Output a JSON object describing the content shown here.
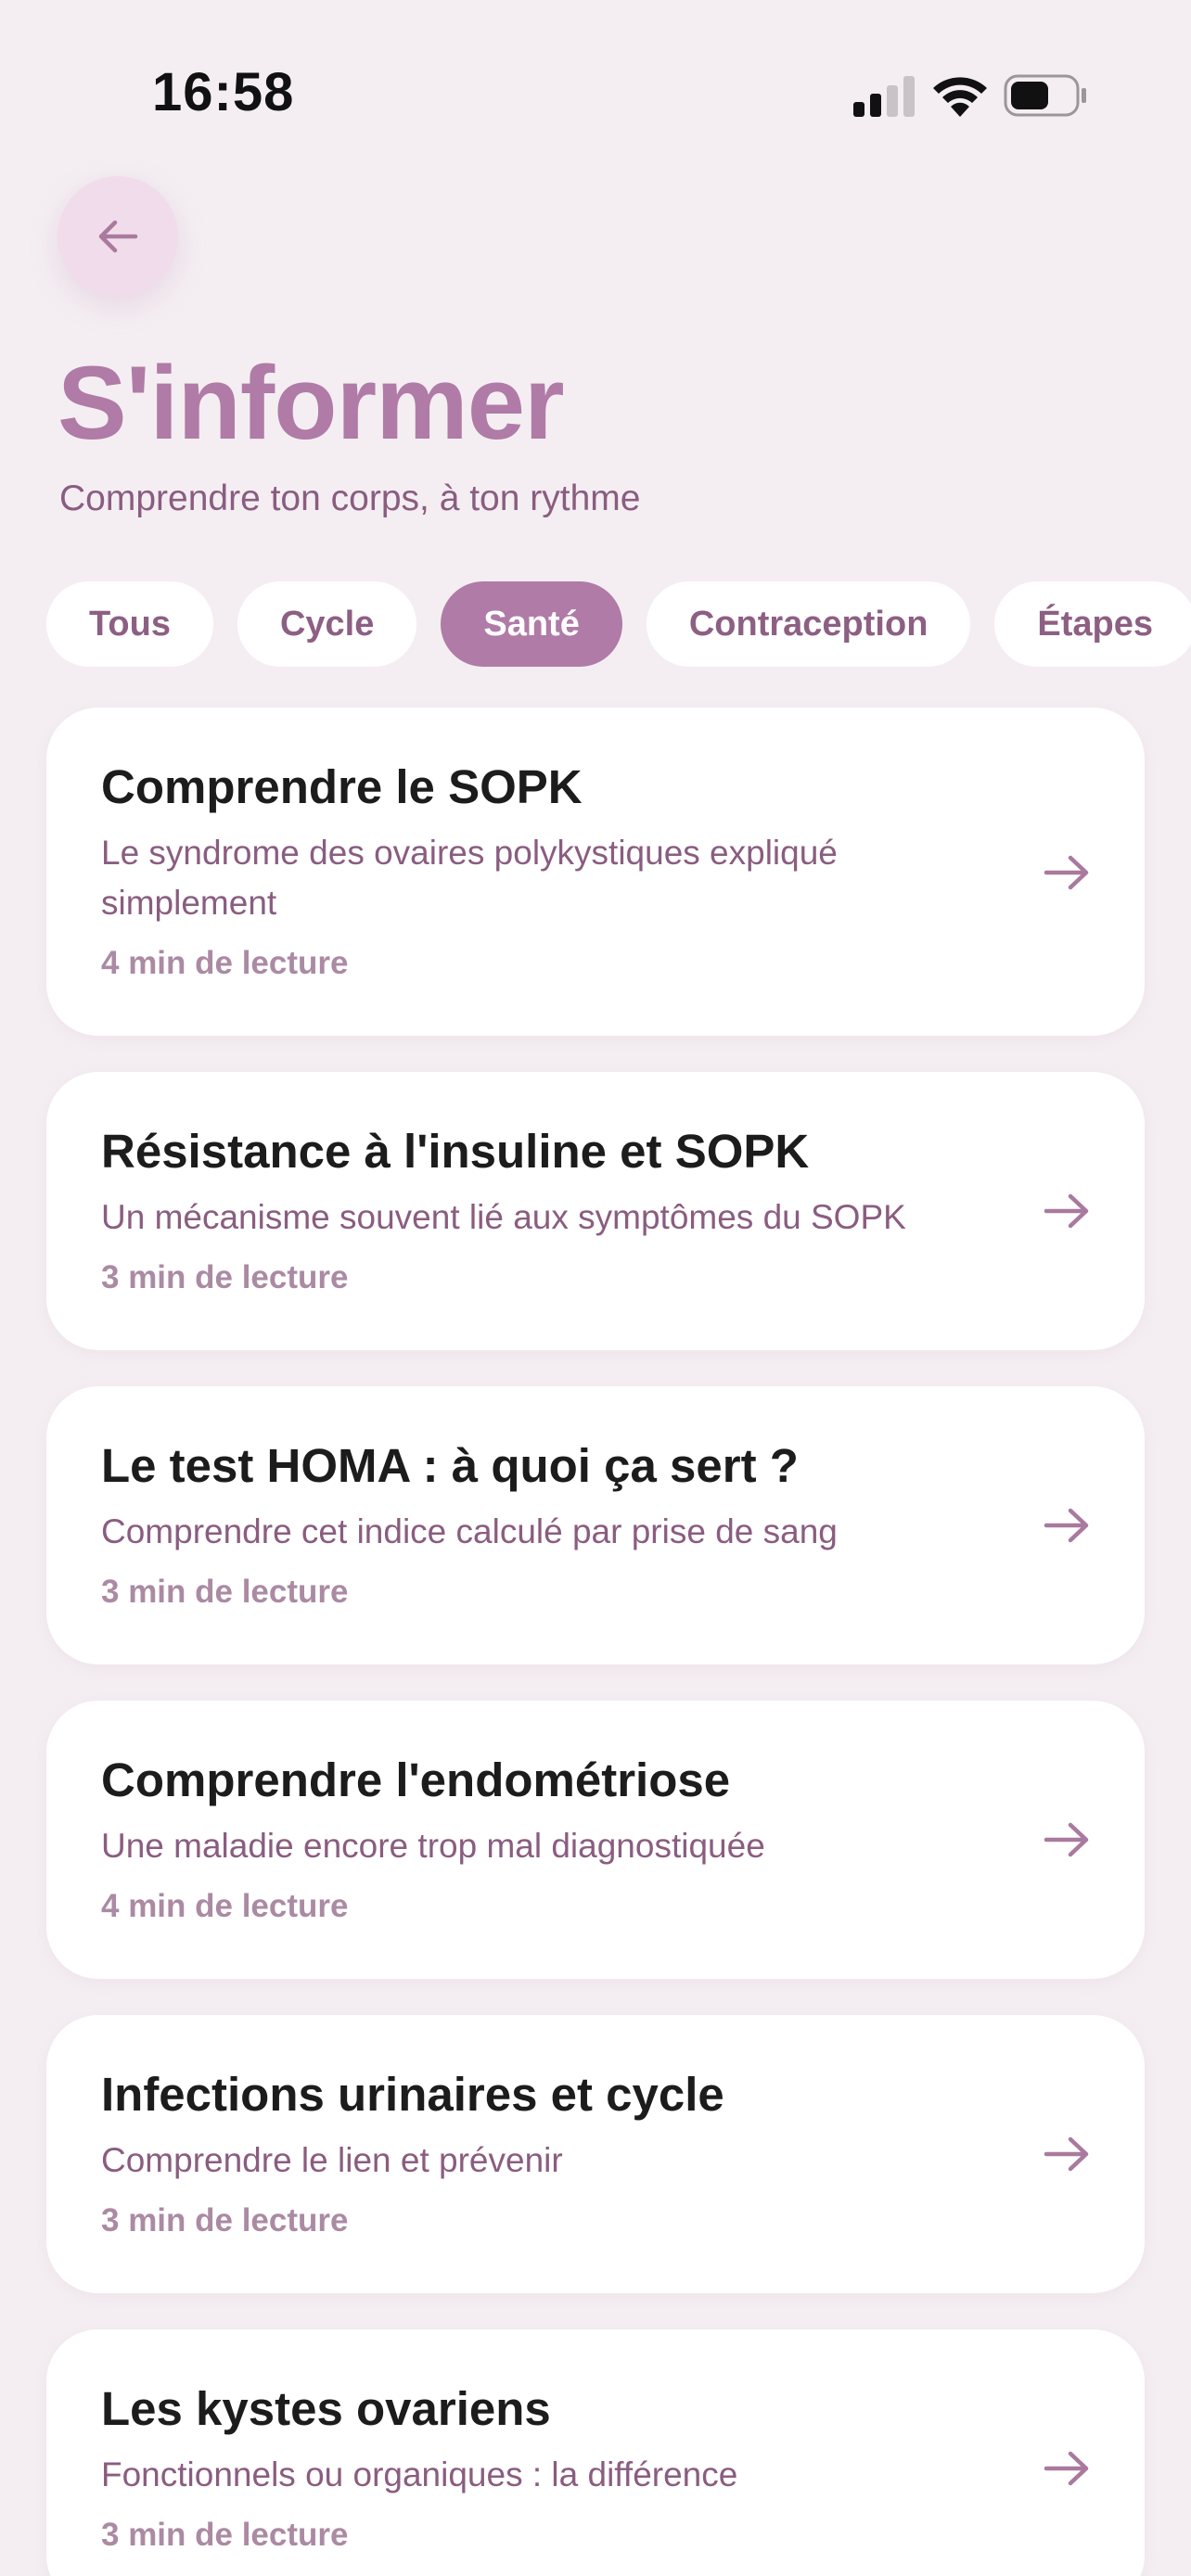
{
  "status_bar": {
    "time": "16:58"
  },
  "header": {
    "title": "S'informer",
    "subtitle": "Comprendre ton corps, à ton rythme"
  },
  "filters": {
    "chips": [
      {
        "label": "Tous",
        "active": false
      },
      {
        "label": "Cycle",
        "active": false
      },
      {
        "label": "Santé",
        "active": true
      },
      {
        "label": "Contraception",
        "active": false
      },
      {
        "label": "Étapes",
        "active": false
      }
    ]
  },
  "articles": [
    {
      "title": "Comprendre le SOPK",
      "description": "Le syndrome des ovaires polykystiques expliqué simplement",
      "read_time": "4 min de lecture"
    },
    {
      "title": "Résistance à l'insuline et SOPK",
      "description": "Un mécanisme souvent lié aux symptômes du SOPK",
      "read_time": "3 min de lecture"
    },
    {
      "title": "Le test HOMA : à quoi ça sert ?",
      "description": "Comprendre cet indice calculé par prise de sang",
      "read_time": "3 min de lecture"
    },
    {
      "title": "Comprendre l'endométriose",
      "description": "Une maladie encore trop mal diagnostiquée",
      "read_time": "4 min de lecture"
    },
    {
      "title": "Infections urinaires et cycle",
      "description": "Comprendre le lien et prévenir",
      "read_time": "3 min de lecture"
    },
    {
      "title": "Les kystes ovariens",
      "description": "Fonctionnels ou organiques : la différence",
      "read_time": "3 min de lecture"
    }
  ],
  "colors": {
    "accent": "#b07ba6",
    "background": "#f4eef2",
    "text_secondary": "#8a5d80"
  },
  "icons": {
    "back": "arrow-left-icon",
    "article_link": "arrow-right-icon",
    "status": [
      "signal-icon",
      "wifi-icon",
      "battery-icon"
    ]
  }
}
